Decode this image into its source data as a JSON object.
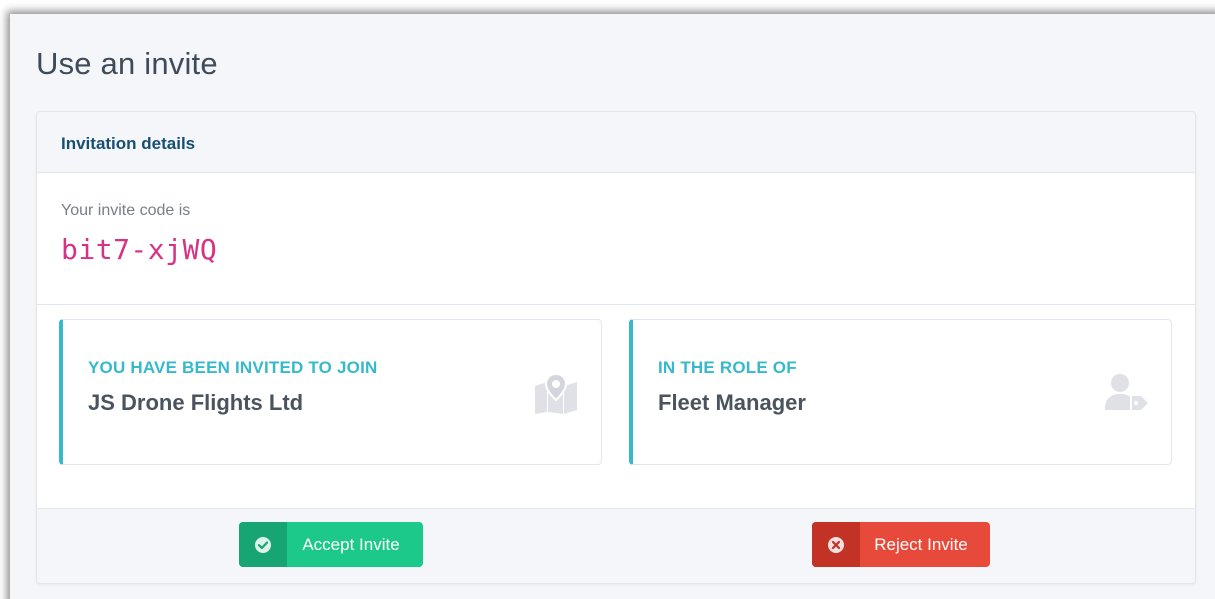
{
  "page": {
    "title": "Use an invite"
  },
  "card": {
    "header_title": "Invitation details",
    "code_label": "Your invite code is",
    "code_value": "bit7-xjWQ"
  },
  "org_box": {
    "label": "You have been invited to join",
    "value": "JS Drone Flights Ltd",
    "icon": "map-marker-icon"
  },
  "role_box": {
    "label": "In the role of",
    "value": "Fleet Manager",
    "icon": "user-tag-icon"
  },
  "actions": {
    "accept_label": "Accept Invite",
    "accept_icon": "check-circle-icon",
    "reject_label": "Reject Invite",
    "reject_icon": "times-circle-icon"
  },
  "colors": {
    "accent_info": "#36b9cc",
    "header_title": "#174f73",
    "code": "#d63384",
    "success": "#1cc88a",
    "danger": "#e74a3b"
  }
}
